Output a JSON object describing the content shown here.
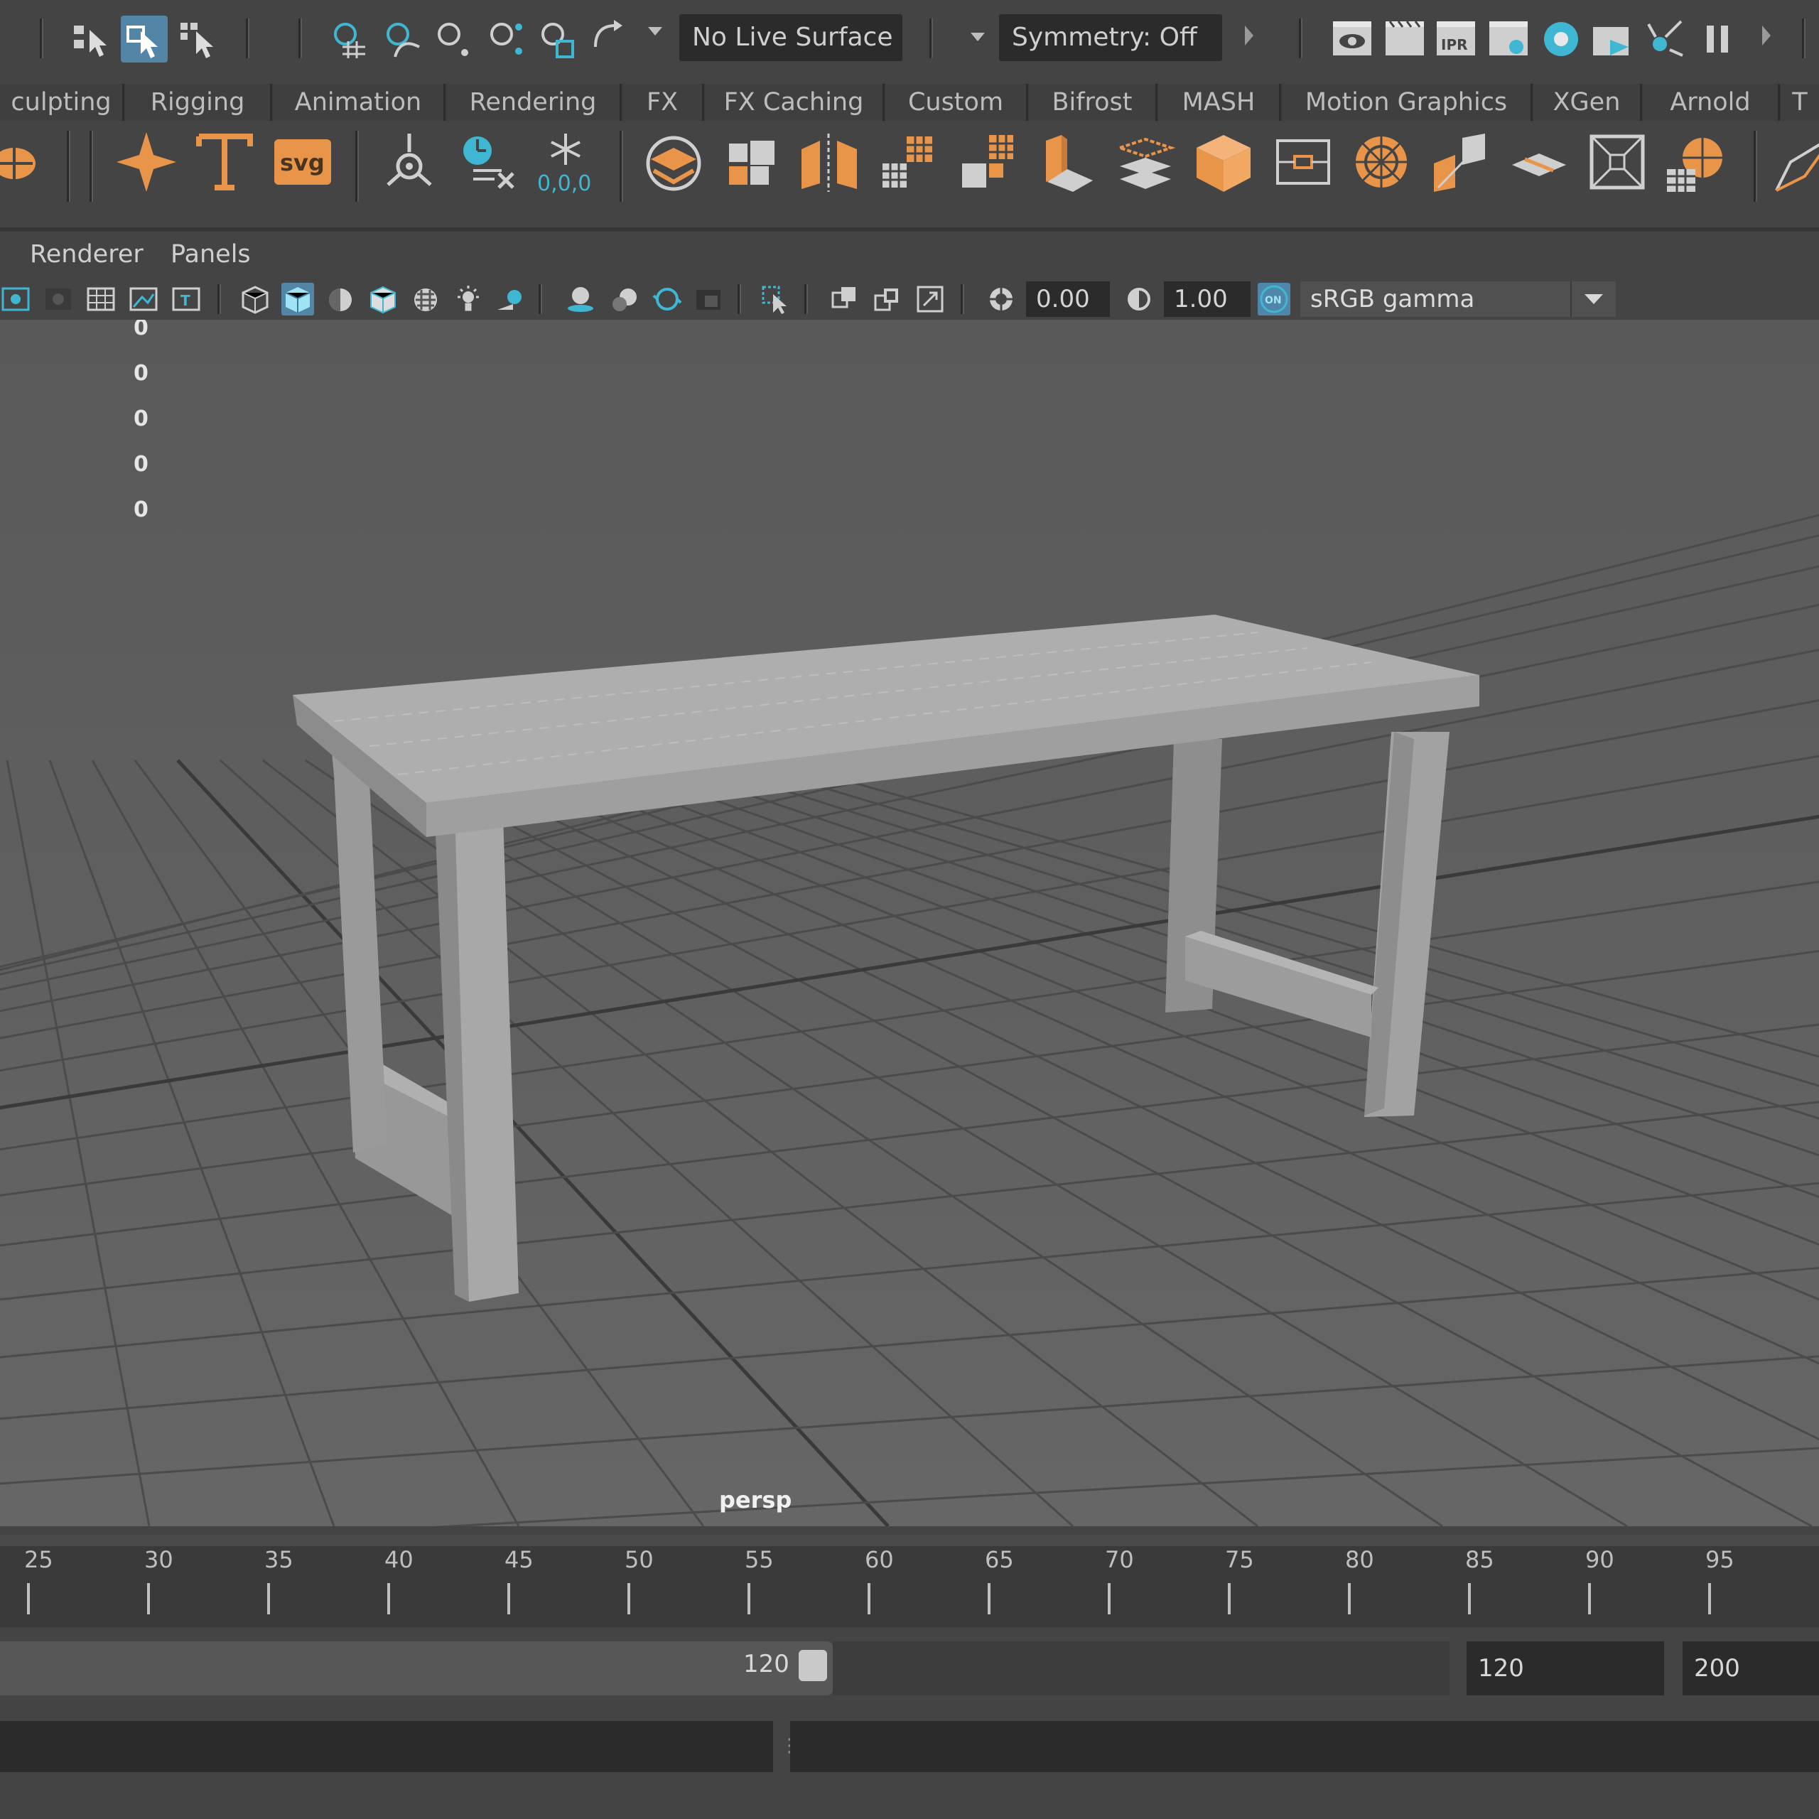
{
  "status_line": {
    "live_surface": "No Live Surface",
    "symmetry": "Symmetry: Off"
  },
  "shelf_tabs": [
    "culpting",
    "Rigging",
    "Animation",
    "Rendering",
    "FX",
    "FX Caching",
    "Custom",
    "Bifrost",
    "MASH",
    "Motion Graphics",
    "XGen",
    "Arnold",
    "T"
  ],
  "shelf_icons": [
    "tangent-icon",
    "sweep-mesh-icon",
    "type-icon",
    "svg-icon",
    "center-pivot-icon",
    "delete-history-icon",
    "freeze-transforms-icon",
    "polygon-sphere-icon",
    "combine-icon",
    "separate-icon",
    "smooth-icon",
    "extract-icon",
    "extrude-icon",
    "bridge-icon",
    "cube-icon",
    "bevel-icon",
    "edge-loop-icon",
    "mirror-icon",
    "multi-cut-icon",
    "uv-editor-icon",
    "target-weld-icon",
    "quad-draw-icon"
  ],
  "panel_menu": {
    "renderer": "Renderer",
    "panels": "Panels"
  },
  "panel_toolbar": {
    "exposure": "0.00",
    "gamma": "1.00",
    "color_space": "sRGB gamma",
    "color_management_badge": "ON"
  },
  "viewport": {
    "hud_values": [
      "0",
      "0",
      "0",
      "0",
      "0"
    ],
    "camera": "persp",
    "colors": {
      "background": "#5e5e5e",
      "grid": "#4b4b4b",
      "grid_axis": "#3a3a3a",
      "table": "#a9a9a9"
    }
  },
  "time_slider": {
    "ticks": [
      "25",
      "30",
      "35",
      "40",
      "45",
      "50",
      "55",
      "60",
      "65",
      "70",
      "75",
      "80",
      "85",
      "90",
      "95"
    ]
  },
  "range_slider": {
    "current_end": "120",
    "playback_end": "120",
    "animation_end": "200"
  },
  "accent_color": "#5285a6",
  "icon_orange": "#e8954a",
  "icon_teal": "#3fb7d3"
}
